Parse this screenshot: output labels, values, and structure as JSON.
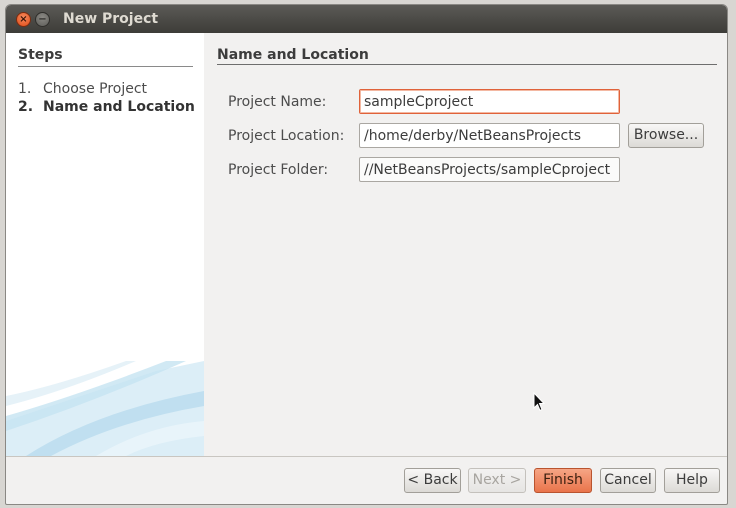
{
  "window": {
    "title": "New Project"
  },
  "steps": {
    "heading": "Steps",
    "items": [
      {
        "number": "1.",
        "label": "Choose Project",
        "current": false
      },
      {
        "number": "2.",
        "label": "Name and Location",
        "current": true
      }
    ]
  },
  "content": {
    "heading": "Name and Location",
    "fields": {
      "project_name": {
        "label": "Project Name:",
        "value": "sampleCproject"
      },
      "project_location": {
        "label": "Project Location:",
        "value": "/home/derby/NetBeansProjects"
      },
      "project_folder": {
        "label": "Project Folder:",
        "value": "//NetBeansProjects/sampleCproject"
      }
    },
    "browse_label": "Browse..."
  },
  "buttons": {
    "back": "< Back",
    "next": "Next >",
    "finish": "Finish",
    "cancel": "Cancel",
    "help": "Help"
  },
  "colors": {
    "accent": "#e9744b",
    "titlebar": "#3d3c38"
  }
}
